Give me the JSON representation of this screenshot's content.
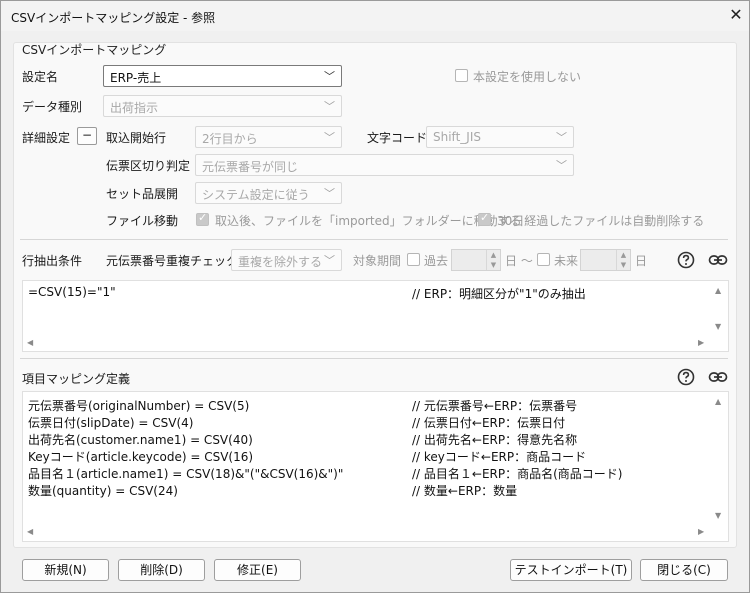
{
  "window": {
    "title": "CSVインポートマッピング設定 - 参照",
    "close": "✕"
  },
  "group": {
    "legend": "CSVインポートマッピング"
  },
  "settings": {
    "name_label": "設定名",
    "name_value": "ERP-売上",
    "disable_label": "本設定を使用しない",
    "data_type_label": "データ種別",
    "data_type_value": "出荷指示",
    "detail_label": "詳細設定",
    "detail_toggle": "−",
    "start_row_label": "取込開始行",
    "start_row_value": "2行目から",
    "charset_label": "文字コード",
    "charset_value": "Shift_JIS",
    "slip_label": "伝票区切り判定",
    "slip_value": "元伝票番号が同じ",
    "set_label": "セット品展開",
    "set_value": "システム設定に従う",
    "file_move_label": "ファイル移動",
    "file_move_opt1": "取込後、ファイルを「imported」フォルダーに移動する",
    "file_move_opt2": "30日経過したファイルは自動削除する"
  },
  "row_filter": {
    "label": "行抽出条件",
    "dup_check_label": "元伝票番号重複チェック",
    "dup_check_value": "重複を除外する",
    "period_label": "対象期間",
    "past_label": "過去",
    "day_label": "日 ～",
    "future_label": "未来",
    "day_label2": "日",
    "line1_code": "=CSV(15)=\"1\"",
    "line1_comment": "// ERP：明細区分が\"1\"のみ抽出"
  },
  "mapping": {
    "label": "項目マッピング定義",
    "lines": [
      {
        "code": "元伝票番号(originalNumber) = CSV(5)",
        "comment": "// 元伝票番号←ERP：伝票番号"
      },
      {
        "code": "伝票日付(slipDate) = CSV(4)",
        "comment": "// 伝票日付←ERP：伝票日付"
      },
      {
        "code": "出荷先名(customer.name1) = CSV(40)",
        "comment": "// 出荷先名←ERP：得意先名称"
      },
      {
        "code": "Keyコード(article.keycode) = CSV(16)",
        "comment": "// keyコード←ERP：商品コード"
      },
      {
        "code": "品目名１(article.name1) = CSV(18)&\"(\"&CSV(16)&\")\"",
        "comment": "// 品目名１←ERP：商品名(商品コード)"
      },
      {
        "code": "数量(quantity) = CSV(24)",
        "comment": "// 数量←ERP：数量"
      }
    ]
  },
  "buttons": {
    "new": "新規(N)",
    "delete": "削除(D)",
    "edit": "修正(E)",
    "test_import": "テストインポート(T)",
    "close": "閉じる(C)"
  },
  "icons": {
    "help": "help-icon",
    "link": "link-icon",
    "dropdown": "chevron-down-icon"
  }
}
